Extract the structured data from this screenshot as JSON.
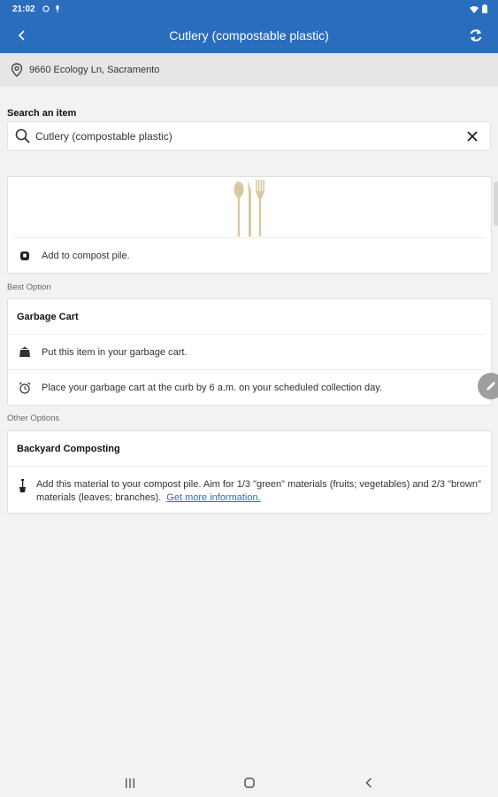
{
  "status_bar": {
    "time": "21:02"
  },
  "header": {
    "title": "Cutlery (compostable plastic)"
  },
  "location": {
    "address": "9660 Ecology Ln, Sacramento"
  },
  "search": {
    "label": "Search an item",
    "value": "Cutlery (compostable plastic)"
  },
  "item": {
    "instruction": "Add to compost pile."
  },
  "best_option": {
    "section_label": "Best Option",
    "title": "Garbage Cart",
    "rows": [
      {
        "icon": "garbage-cart-icon",
        "text": "Put this item in your garbage cart."
      },
      {
        "icon": "alarm-clock-icon",
        "text": "Place your garbage cart at the curb by 6 a.m. on your scheduled collection day."
      }
    ]
  },
  "other_options": {
    "section_label": "Other Options",
    "title": "Backyard Composting",
    "text": "Add this material to your compost pile. Aim for 1/3 \"green\" materials (fruits; vegetables) and 2/3 \"brown\" materials (leaves; branches).",
    "link_text": "Get more information."
  },
  "colors": {
    "primary": "#2a6dbd",
    "link": "#2a6dbd"
  }
}
